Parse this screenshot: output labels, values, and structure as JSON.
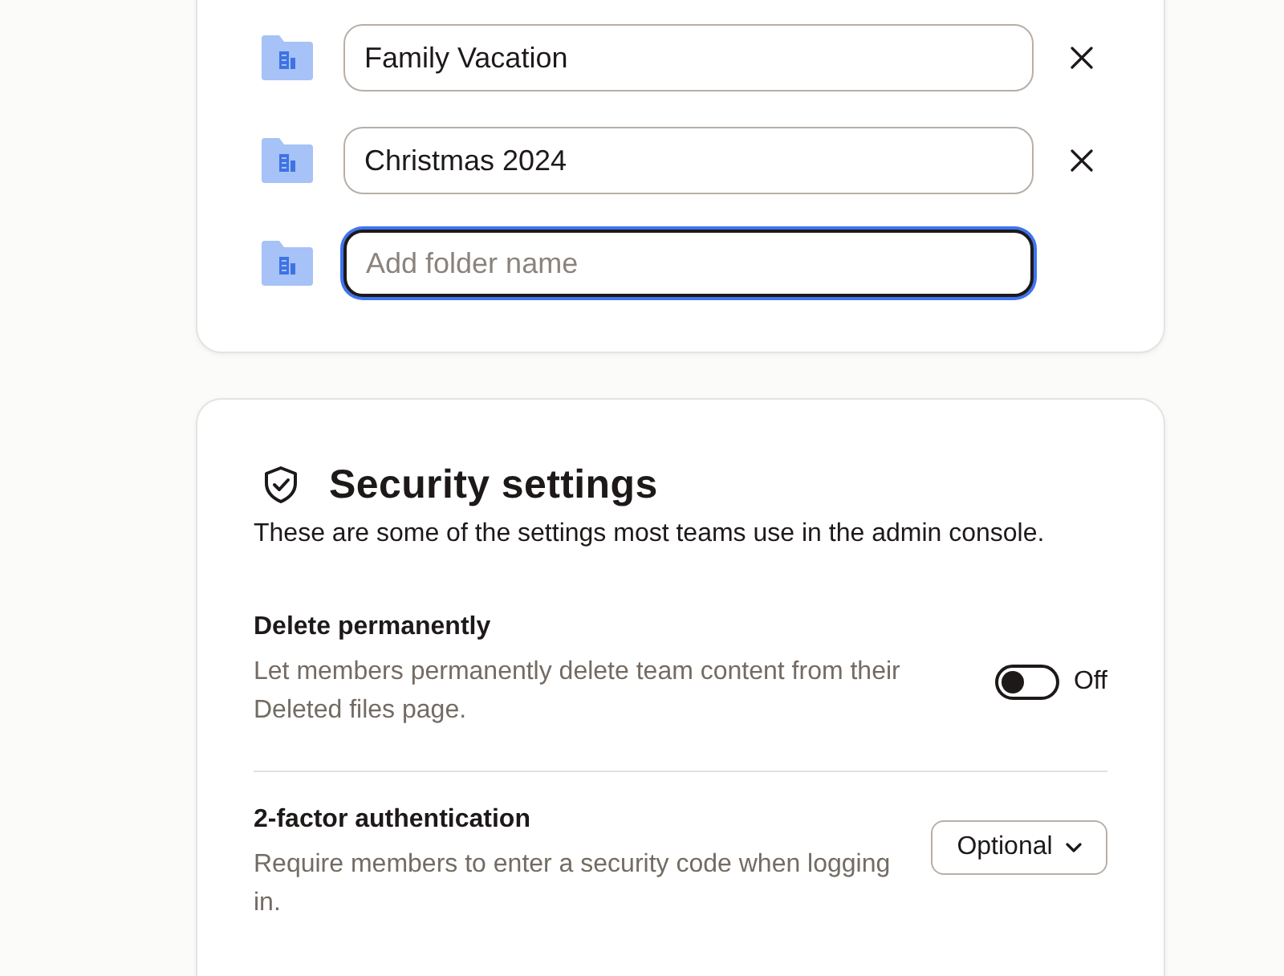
{
  "folders": [
    {
      "value": "Family Vacation",
      "focused": false
    },
    {
      "value": "Christmas 2024",
      "focused": false
    },
    {
      "placeholder": "Add folder name",
      "focused": true
    }
  ],
  "security": {
    "title": "Security settings",
    "description": "These are some of the settings most teams use in the admin console.",
    "settings": [
      {
        "kind": "toggle",
        "title": "Delete permanently",
        "description": "Let members permanently delete team content from their Deleted files page.",
        "on": false,
        "state_label": "Off"
      },
      {
        "kind": "dropdown",
        "title": "2-factor authentication",
        "description": "Require members to enter a security code when logging in.",
        "value": "Optional"
      }
    ]
  }
}
